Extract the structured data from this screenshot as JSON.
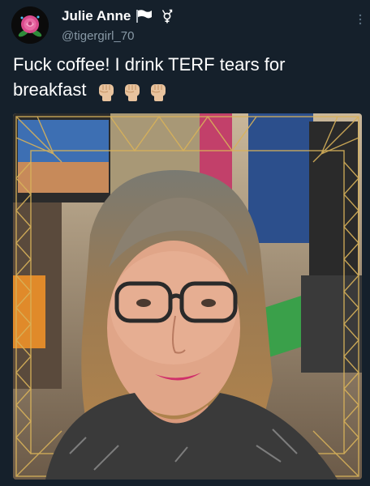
{
  "tweet": {
    "display_name": "Julie Anne",
    "handle": "@tigergirl_70",
    "text": "Fuck coffee! I drink TERF tears for breakfast",
    "name_icons": [
      "white-flag-icon",
      "transgender-symbol-icon"
    ],
    "reaction_icons": [
      "raised-fist-icon",
      "raised-fist-icon",
      "raised-fist-icon"
    ]
  },
  "colors": {
    "background": "#15202b",
    "handle": "#8899a6",
    "text": "#ffffff",
    "fist": "#e8c39e"
  }
}
